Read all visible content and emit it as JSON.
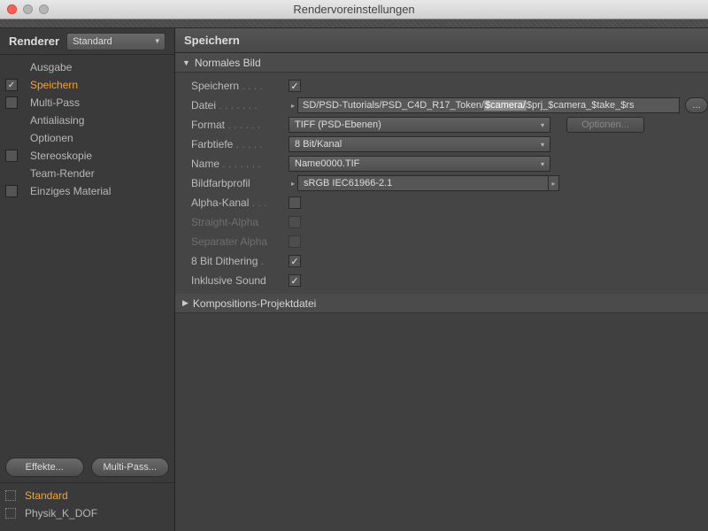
{
  "window": {
    "title": "Rendervoreinstellungen"
  },
  "sidebar": {
    "renderer_label": "Renderer",
    "renderer_value": "Standard",
    "items": [
      {
        "label": "Ausgabe",
        "checked": "blank"
      },
      {
        "label": "Speichern",
        "checked": "on",
        "active": true
      },
      {
        "label": "Multi-Pass",
        "checked": "off"
      },
      {
        "label": "Antialiasing",
        "checked": "blank"
      },
      {
        "label": "Optionen",
        "checked": "blank"
      },
      {
        "label": "Stereoskopie",
        "checked": "off"
      },
      {
        "label": "Team-Render",
        "checked": "blank"
      },
      {
        "label": "Einziges Material",
        "checked": "off"
      }
    ],
    "effects_btn": "Effekte...",
    "multipass_btn": "Multi-Pass...",
    "presets": [
      {
        "label": "Standard",
        "active": true
      },
      {
        "label": "Physik_K_DOF",
        "active": false
      }
    ]
  },
  "panel": {
    "title": "Speichern",
    "group1_title": "Normales Bild",
    "save_label": "Speichern",
    "file_label": "Datei",
    "file_value_pre": "SD/PSD-Tutorials/PSD_C4D_R17_Token/",
    "file_value_hl": "$camera/",
    "file_value_post": "$prj_$camera_$take_$rs",
    "file_dots": "...",
    "format_label": "Format",
    "format_value": "TIFF (PSD-Ebenen)",
    "options_btn": "Optionen...",
    "depth_label": "Farbtiefe",
    "depth_value": "8 Bit/Kanal",
    "name_label": "Name",
    "name_value": "Name0000.TIF",
    "profile_label": "Bildfarbprofil",
    "profile_value": "sRGB IEC61966-2.1",
    "alpha_label": "Alpha-Kanal",
    "straight_label": "Straight-Alpha",
    "sepalpha_label": "Separater Alpha",
    "dither_label": "8 Bit Dithering",
    "sound_label": "Inklusive Sound",
    "group2_title": "Kompositions-Projektdatei"
  }
}
